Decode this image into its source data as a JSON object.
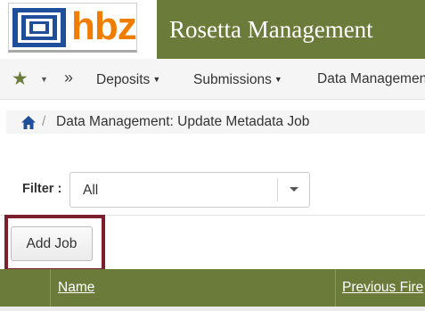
{
  "header": {
    "logo_text": "hbz",
    "app_title": "Rosetta Management",
    "brand_color": "#6b7c3a",
    "logo_color": "#f07d00"
  },
  "nav": {
    "favorites_icon": "star-icon",
    "favorites_caret": "▼",
    "more_icon": "»",
    "items": [
      {
        "label": "Deposits",
        "caret": "▼"
      },
      {
        "label": "Submissions",
        "caret": "▼"
      },
      {
        "label": "Data Management",
        "caret": ""
      }
    ]
  },
  "breadcrumb": {
    "home_icon": "home-icon",
    "separator": "/",
    "current": "Data Management: Update Metadata Job"
  },
  "filter": {
    "label": "Filter :",
    "selected": "All"
  },
  "actions": {
    "add_job_label": "Add Job",
    "highlight_color": "#7b1f2f"
  },
  "table": {
    "columns": [
      {
        "label": ""
      },
      {
        "label": "Name"
      },
      {
        "label": "Previous Fire"
      }
    ]
  }
}
